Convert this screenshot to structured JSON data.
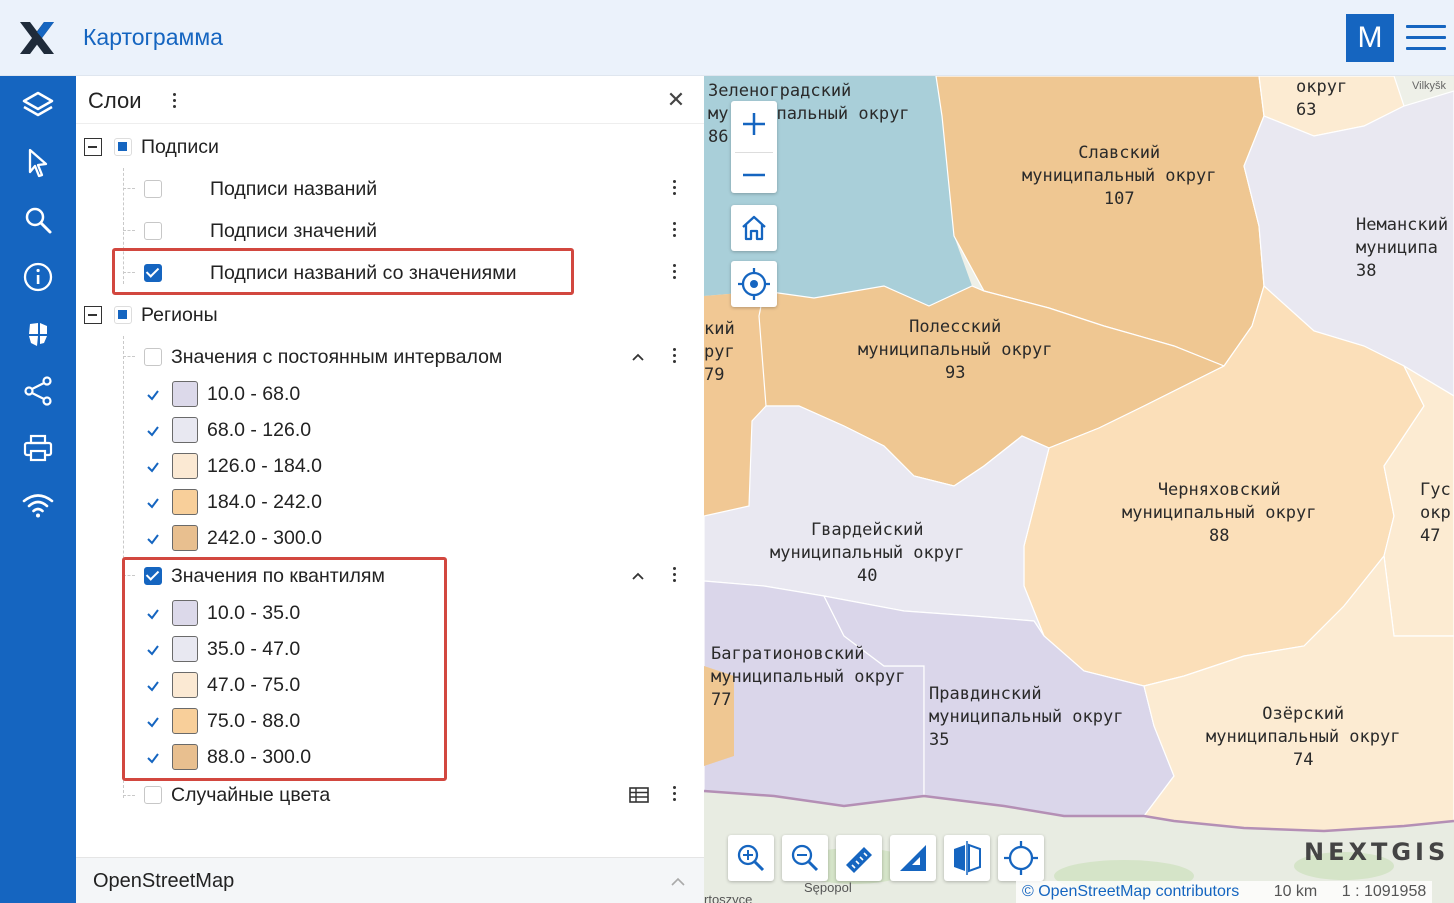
{
  "app": {
    "title": "Картограмма",
    "user_initial": "M",
    "accent": "#1565c0"
  },
  "left_toolbar": [
    "layers-icon",
    "select-icon",
    "search-icon",
    "info-icon",
    "cartogram-icon",
    "share-icon",
    "print-icon",
    "wifi-icon"
  ],
  "panel": {
    "title": "Слои",
    "groups": {
      "captions": {
        "label": "Подписи",
        "items": [
          {
            "label": "Подписи названий",
            "checked": false
          },
          {
            "label": "Подписи значений",
            "checked": false
          },
          {
            "label": "Подписи названий со значениями",
            "checked": true
          }
        ]
      },
      "regions": {
        "label": "Регионы",
        "constant": {
          "label": "Значения с постоянным интервалом",
          "checked": false,
          "classes": [
            {
              "range": "10.0 - 68.0",
              "color": "#dcd9ea"
            },
            {
              "range": "68.0 - 126.0",
              "color": "#e8e8f1"
            },
            {
              "range": "126.0 - 184.0",
              "color": "#fbe9d3"
            },
            {
              "range": "184.0 - 242.0",
              "color": "#f8cf9a"
            },
            {
              "range": "242.0 - 300.0",
              "color": "#e8bf8f"
            }
          ]
        },
        "quantile": {
          "label": "Значения по квантилям",
          "checked": true,
          "classes": [
            {
              "range": "10.0 - 35.0",
              "color": "#dcd9ea"
            },
            {
              "range": "35.0 - 47.0",
              "color": "#e8e8f1"
            },
            {
              "range": "47.0 - 75.0",
              "color": "#fbe9d3"
            },
            {
              "range": "75.0 - 88.0",
              "color": "#f8cf9a"
            },
            {
              "range": "88.0 - 300.0",
              "color": "#e8bf8f"
            }
          ]
        },
        "random": {
          "label": "Случайные цвета",
          "checked": false
        }
      }
    },
    "basemap": "OpenStreetMap"
  },
  "map": {
    "labels": {
      "zelenogradsk": {
        "l1": "Зеленоградский",
        "l2": "му",
        "l3": "пальный округ",
        "l4": "86"
      },
      "slavsk": {
        "l1": "Славский",
        "l2": "муниципальный округ",
        "l3": "107"
      },
      "neman": {
        "l1": "Неманский",
        "l2": "муниципа",
        "l3": "38"
      },
      "polessk": {
        "l1": "Полесский",
        "l2": "муниципальный округ",
        "l3": "93"
      },
      "west": {
        "l1": "кий",
        "l2": "руг",
        "l3": "79"
      },
      "chernyakhovsk": {
        "l1": "Черняховский",
        "l2": "муниципальный округ",
        "l3": "88"
      },
      "gusev": {
        "l1": "Гус",
        "l2": "окр",
        "l3": "47"
      },
      "gvardeysk": {
        "l1": "Гвардейский",
        "l2": "муниципальный округ",
        "l3": "40"
      },
      "bagrationovsk": {
        "l1": "Багратионовский",
        "l2": "муниципальный округ",
        "l3": "77"
      },
      "pravdinsk": {
        "l1": "Правдинский",
        "l2": "муниципальный округ",
        "l3": "35"
      },
      "ozersk": {
        "l1": "Озёрский",
        "l2": "муниципальный округ",
        "l3": "74"
      },
      "top_right": {
        "l1": "округ",
        "l2": "63"
      },
      "vilkysk": "Vilkyšk",
      "sepopol": "Sępopol",
      "bartoszyce": "rtoszyce"
    },
    "brand": "NEXTGIS",
    "attribution": "© OpenStreetMap contributors",
    "scale_text": "10 km",
    "scale_ratio": "1 : 1091958"
  }
}
